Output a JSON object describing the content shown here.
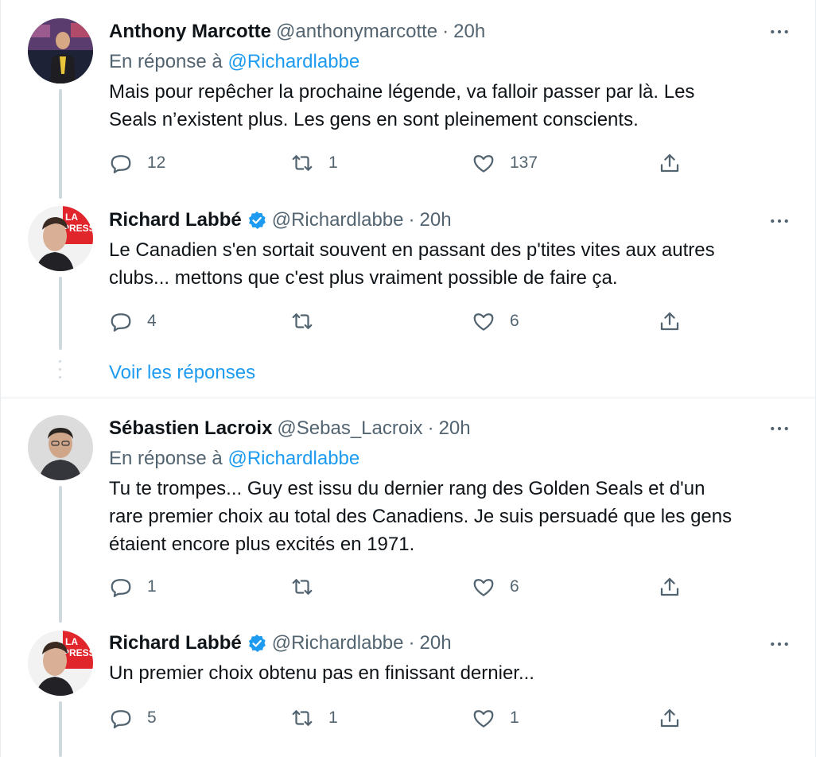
{
  "conversation": {
    "see_replies_label": "Voir les réponses",
    "tweets": [
      {
        "name": "Anthony Marcotte",
        "handle": "@anthonymarcotte",
        "time": "20h",
        "reply_prefix": "En réponse à",
        "reply_mention": "@Richardlabbe",
        "text_line1": "Mais pour repêcher la prochaine légende, va falloir passer par là. Les",
        "text_line2": "Seals n’existent plus. Les gens en sont pleinement conscients.",
        "replies": "12",
        "retweets": "1",
        "likes": "137",
        "verified": false
      },
      {
        "name": "Richard Labbé",
        "handle": "@Richardlabbe",
        "time": "20h",
        "text_line1": "Le Canadien s'en sortait souvent en passant des p'tites vites aux autres",
        "text_line2": "clubs... mettons que c'est plus vraiment possible de faire ça.",
        "replies": "4",
        "retweets": "",
        "likes": "6",
        "verified": true,
        "avatar_badge": "LA PRESSE"
      },
      {
        "name": "Sébastien Lacroix",
        "handle": "@Sebas_Lacroix",
        "time": "20h",
        "reply_prefix": "En réponse à",
        "reply_mention": "@Richardlabbe",
        "text_line1": "Tu te trompes... Guy est issu du dernier rang des Golden Seals et d'un",
        "text_line2": "rare premier choix au total des Canadiens. Je suis persuadé que les gens",
        "text_line3": "étaient encore plus excités en 1971.",
        "replies": "1",
        "retweets": "",
        "likes": "6",
        "verified": false
      },
      {
        "name": "Richard Labbé",
        "handle": "@Richardlabbe",
        "time": "20h",
        "text_line1": "Un premier choix obtenu pas en finissant dernier...",
        "replies": "5",
        "retweets": "1",
        "likes": "1",
        "verified": true,
        "avatar_badge": "LA PRESSE"
      }
    ]
  },
  "theme": {
    "accent": "#1d9bf0",
    "text": "#0f1419",
    "secondary": "#536471",
    "thread_line": "#cfd9de",
    "badge_red": "#e0252b"
  },
  "icons": {
    "reply": "speech-bubble-icon",
    "retweet": "retweet-icon",
    "like": "heart-icon",
    "share": "share-upload-icon",
    "more": "more-dots-icon",
    "verified": "verified-badge-icon"
  },
  "separator": "·"
}
